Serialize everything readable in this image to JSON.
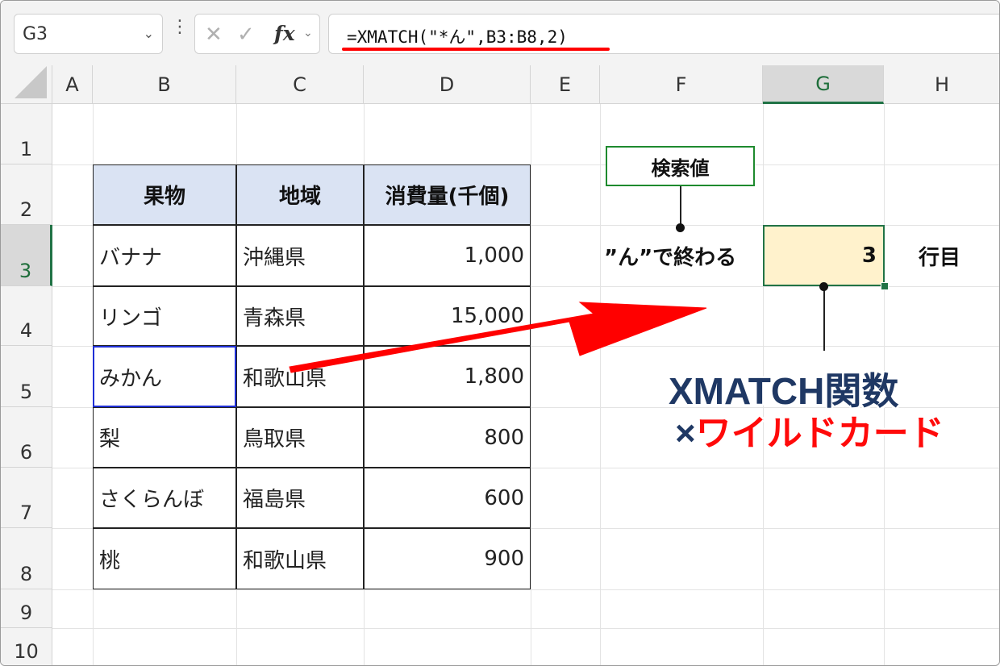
{
  "formula_bar": {
    "name_box": "G3",
    "cancel_icon": "✕",
    "confirm_icon": "✓",
    "fx_label": "fx",
    "formula": "=XMATCH(\"*ん\",B3:B8,2)"
  },
  "columns": [
    "A",
    "B",
    "C",
    "D",
    "E",
    "F",
    "G",
    "H"
  ],
  "rows": [
    "1",
    "2",
    "3",
    "4",
    "5",
    "6",
    "7",
    "8",
    "9",
    "10"
  ],
  "table": {
    "headers": [
      "果物",
      "地域",
      "消費量(千個)"
    ],
    "rows": [
      [
        "バナナ",
        "沖縄県",
        "1,000"
      ],
      [
        "リンゴ",
        "青森県",
        "15,000"
      ],
      [
        "みかん",
        "和歌山県",
        "1,800"
      ],
      [
        "梨",
        "鳥取県",
        "800"
      ],
      [
        "さくらんぼ",
        "福島県",
        "600"
      ],
      [
        "桃",
        "和歌山県",
        "900"
      ]
    ]
  },
  "lookup": {
    "label": "検索値",
    "criteria": "”ん”で終わる",
    "result": "3",
    "unit": "行目"
  },
  "caption": {
    "line1": "XMATCH関数",
    "line2_prefix": "×",
    "line2_red": "ワイルドカード"
  },
  "colors": {
    "header_fill": "#dae3f3",
    "result_fill": "#fff2cc",
    "excel_green": "#217346",
    "selection_blue": "#1f2fd6",
    "arrow_red": "#ff0000",
    "caption_navy": "#1f3864"
  }
}
